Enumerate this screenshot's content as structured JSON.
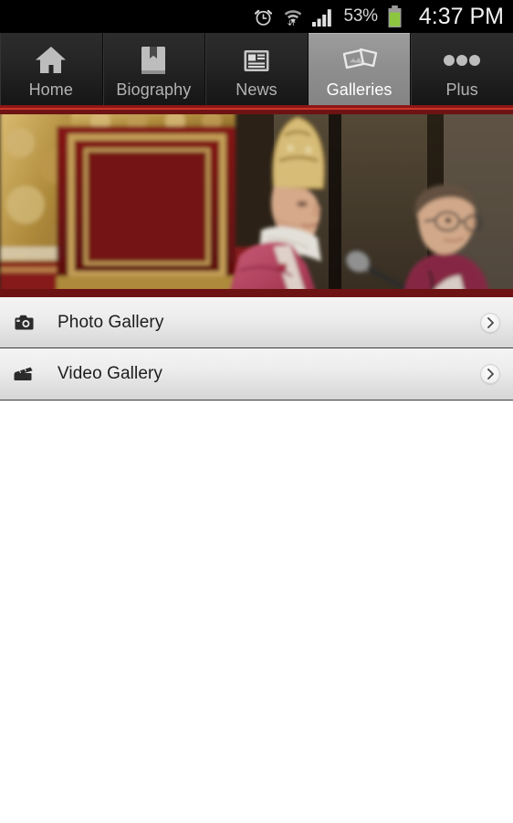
{
  "status_bar": {
    "alarm_icon": "alarm-clock-icon",
    "wifi_icon": "wifi-signal-icon",
    "signal_icon": "cellular-signal-icon",
    "battery_percent": "53%",
    "battery_icon": "battery-icon",
    "battery_color": "#8cc63e",
    "time": "4:37 PM"
  },
  "tabbar": {
    "accent_color": "#8e1616",
    "selected_index": 3,
    "tabs": [
      {
        "label": "Home",
        "icon": "home-icon",
        "selected": false
      },
      {
        "label": "Biography",
        "icon": "book-icon",
        "selected": false
      },
      {
        "label": "News",
        "icon": "newspaper-icon",
        "selected": false
      },
      {
        "label": "Galleries",
        "icon": "photos-stack-icon",
        "selected": true
      },
      {
        "label": "Plus",
        "icon": "more-dots-icon",
        "selected": false
      }
    ]
  },
  "hero": {
    "name": "pope-at-microphone-photo",
    "alt": "Pope in red and gold vestments speaking at a microphone beside an aide, in front of a red and gold throne",
    "border_color": "#6d1313"
  },
  "list": {
    "rows": [
      {
        "label": "Photo Gallery",
        "icon": "camera-icon",
        "chevron": "chevron-right-icon"
      },
      {
        "label": "Video Gallery",
        "icon": "video-clapper-icon",
        "chevron": "chevron-right-icon"
      }
    ]
  }
}
